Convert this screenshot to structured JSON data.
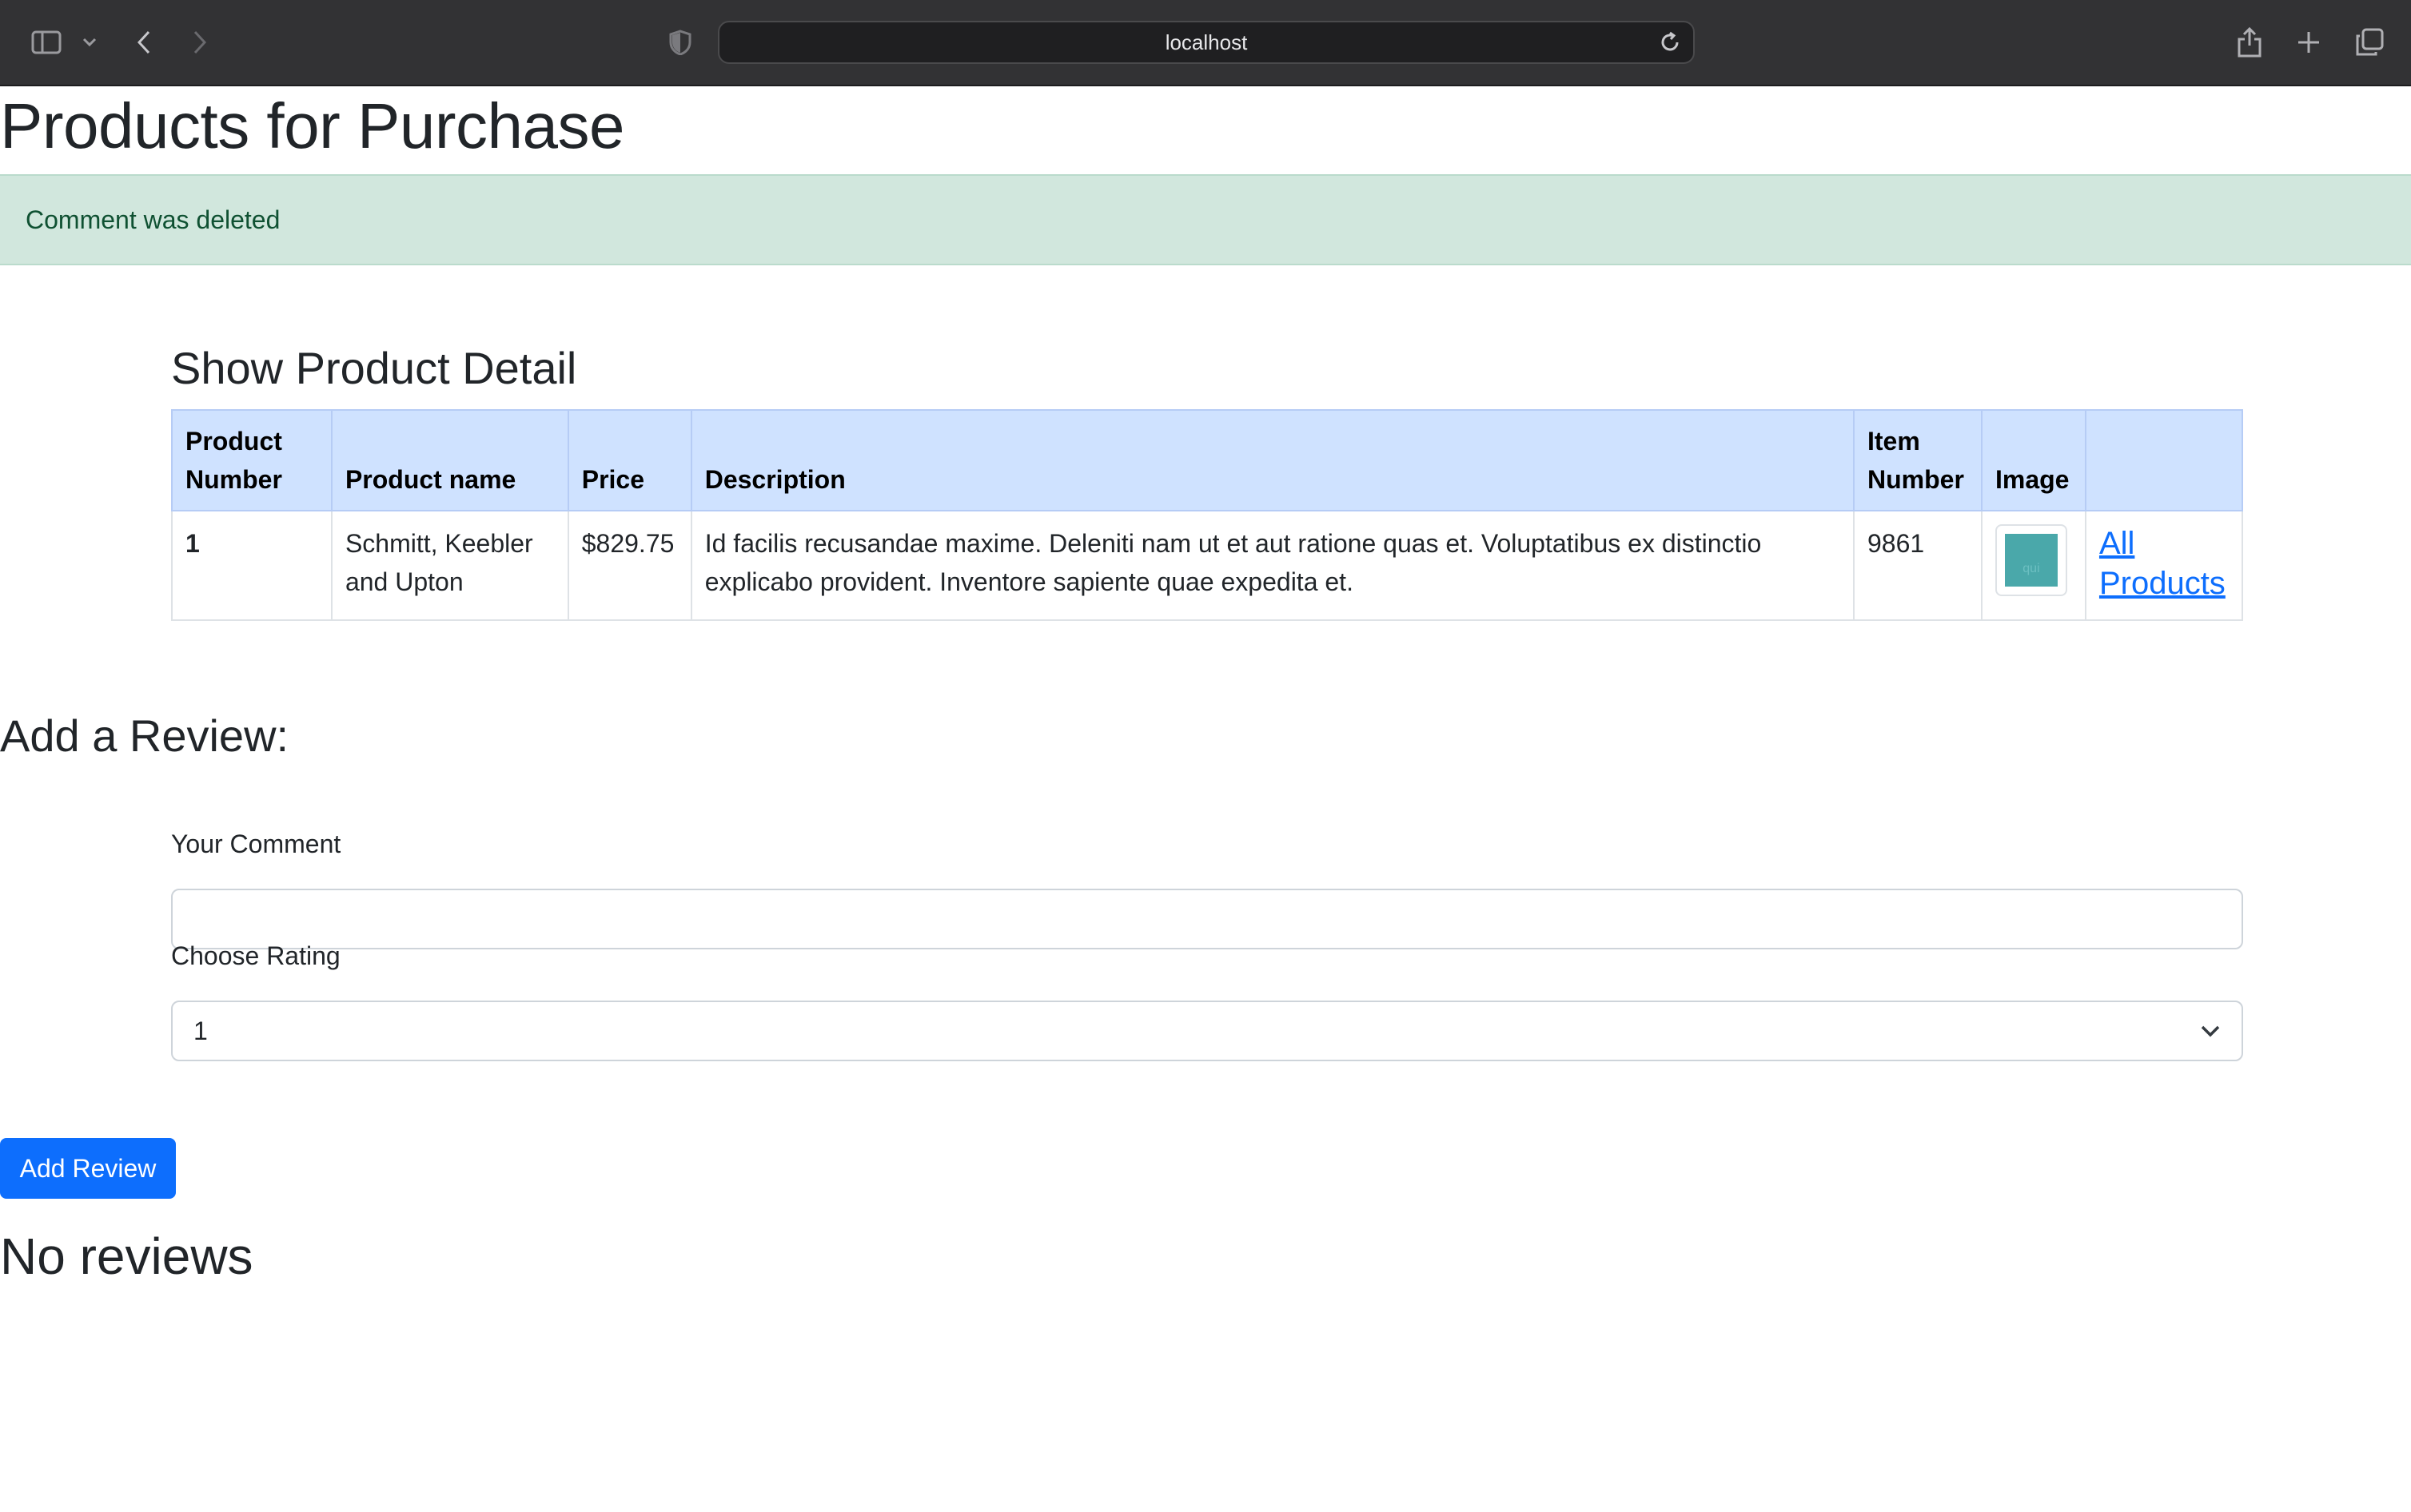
{
  "browser": {
    "url": "localhost",
    "icons": [
      "sidebar-icon",
      "chevron-down-icon",
      "back-icon",
      "forward-icon",
      "shield-icon",
      "reload-icon",
      "share-icon",
      "new-tab-icon",
      "tabs-overview-icon"
    ]
  },
  "page": {
    "title": "Products for Purchase",
    "alert": "Comment was deleted",
    "section_title": "Show Product Detail"
  },
  "table": {
    "headers": [
      "Product Number",
      "Product name",
      "Price",
      "Description",
      "Item Number",
      "Image",
      ""
    ],
    "row": {
      "number": "1",
      "name": "Schmitt, Keebler and Upton",
      "price": "$829.75",
      "description": "Id facilis recusandae maxime. Deleniti nam ut et aut ratione quas et. Voluptatibus ex distinctio explicabo provident. Inventore sapiente quae expedita et.",
      "item_number": "9861",
      "image_alt": "qui",
      "link": "All Products"
    }
  },
  "review_form": {
    "title": "Add a Review:",
    "comment_label": "Your Comment",
    "comment_value": "",
    "rating_label": "Choose Rating",
    "rating_value": "1",
    "submit_label": "Add Review"
  },
  "reviews": {
    "empty_text": "No reviews"
  },
  "colors": {
    "alert_bg": "#d1e7dd",
    "table_header_bg": "#cfe2ff",
    "primary": "#0d6efd"
  }
}
